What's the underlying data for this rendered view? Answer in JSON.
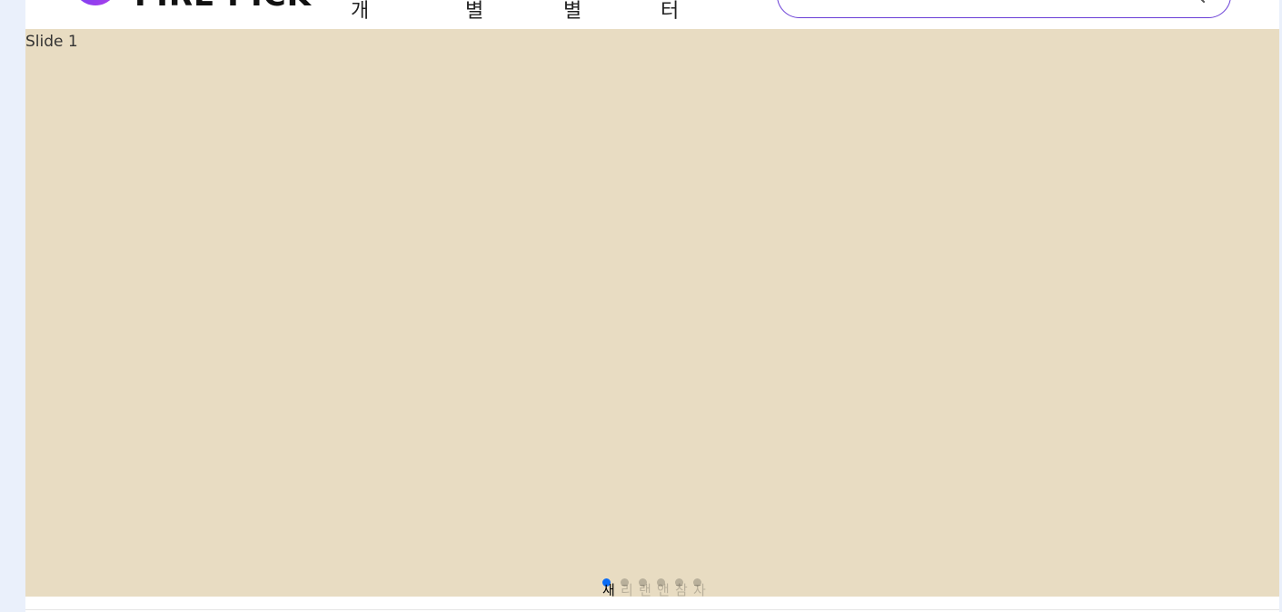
{
  "header": {
    "logo_text": "FIRE PICK",
    "nav": [
      "개",
      "별",
      "별",
      "터"
    ],
    "search": {
      "placeholder": "",
      "icon": "search-icon",
      "border_color": "#6a3fd6"
    }
  },
  "slider": {
    "background_color": "#e8dcc2",
    "current_slide_label": "Slide 1",
    "bullets": [
      {
        "label": "새",
        "active": true
      },
      {
        "label": "리",
        "active": false
      },
      {
        "label": "랜",
        "active": false
      },
      {
        "label": "앤",
        "active": false
      },
      {
        "label": "참",
        "active": false
      },
      {
        "label": "자",
        "active": false
      }
    ],
    "active_bullet_color": "#0a6cf5"
  }
}
